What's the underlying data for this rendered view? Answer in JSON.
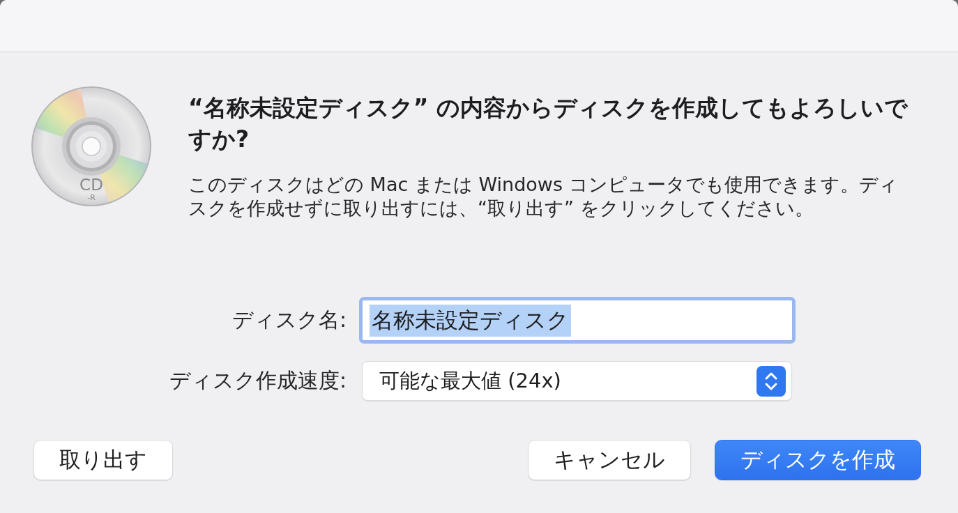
{
  "alert": {
    "icon": {
      "label": "CD",
      "sublabel": "-R"
    },
    "heading": "“名称未設定ディスク” の内容からディスクを作成してもよろしいですか?",
    "message": "このディスクはどの Mac または Windows コンピュータでも使用できます。ディスクを作成せずに取り出すには、“取り出す” をクリックしてください。"
  },
  "form": {
    "fields": [
      {
        "kind": "text",
        "label": "ディスク名:",
        "value": "名称未設定ディスク",
        "focused": true
      },
      {
        "kind": "popup",
        "label": "ディスク作成速度:",
        "value": "可能な最大値 (24x)"
      }
    ]
  },
  "buttons": {
    "left": [
      {
        "label": "取り出す",
        "default": false
      }
    ],
    "right": [
      {
        "label": "キャンセル",
        "default": false
      },
      {
        "label": "ディスクを作成",
        "default": true
      }
    ]
  }
}
